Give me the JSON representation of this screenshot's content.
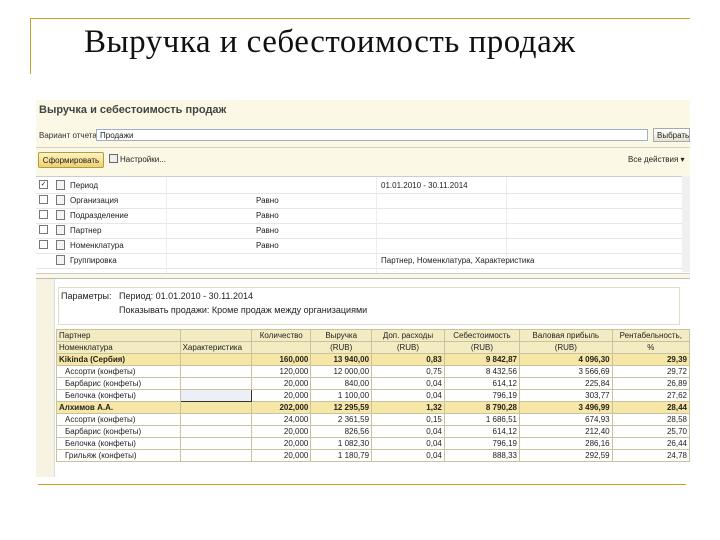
{
  "slide": {
    "title": "Выручка и себестоимость продаж"
  },
  "app": {
    "title": "Выручка и себестоимость продаж",
    "variant_label": "Вариант отчета",
    "variant_value": "Продажи",
    "select_variant_label": "Выбрать вариант...",
    "generate_label": "Сформировать",
    "settings_label": "Настройки...",
    "all_actions_label": "Все действия ▾"
  },
  "filters": [
    {
      "checked": true,
      "name": "Период",
      "condition": "",
      "value": "01.01.2010 - 30.11.2014"
    },
    {
      "checked": false,
      "name": "Организация",
      "condition": "Равно",
      "value": ""
    },
    {
      "checked": false,
      "name": "Подразделение",
      "condition": "Равно",
      "value": ""
    },
    {
      "checked": false,
      "name": "Партнер",
      "condition": "Равно",
      "value": ""
    },
    {
      "checked": false,
      "name": "Номенклатура",
      "condition": "Равно",
      "value": ""
    },
    {
      "checked": null,
      "name": "Группировка",
      "condition": "",
      "value": "Партнер, Номенклатура, Характеристика"
    }
  ],
  "report": {
    "params_label": "Параметры:",
    "period_text": "Период: 01.01.2010 - 30.11.2014",
    "show_text": "Показывать продажи: Кроме продаж между организациями",
    "headers": {
      "partner": "Партнер",
      "nomenclature": "Номенклатура",
      "characteristic": "Характеристика",
      "quantity": "Количество",
      "revenue": "Выручка",
      "revenue_unit": "(RUB)",
      "extra": "Доп. расходы",
      "extra_unit": "(RUB)",
      "cost": "Себестоимость",
      "cost_unit": "(RUB)",
      "profit": "Валовая прибыль",
      "profit_unit": "(RUB)",
      "margin": "Рентабельность,",
      "margin_unit": "%"
    },
    "rows": [
      {
        "type": "group",
        "name": "Kikinda (Сербия)",
        "char": "",
        "qty": "160,000",
        "rev": "13 940,00",
        "extra": "0,83",
        "cost": "9 842,87",
        "profit": "4 096,30",
        "margin": "29,39"
      },
      {
        "type": "item",
        "name": "Ассорти (конфеты)",
        "char": "",
        "qty": "120,000",
        "rev": "12 000,00",
        "extra": "0,75",
        "cost": "8 432,56",
        "profit": "3 566,69",
        "margin": "29,72"
      },
      {
        "type": "item",
        "name": "Барбарис (конфеты)",
        "char": "",
        "qty": "20,000",
        "rev": "840,00",
        "extra": "0,04",
        "cost": "614,12",
        "profit": "225,84",
        "margin": "26,89"
      },
      {
        "type": "item",
        "name": "Белочка (конфеты)",
        "char": "",
        "qty": "20,000",
        "rev": "1 100,00",
        "extra": "0,04",
        "cost": "796,19",
        "profit": "303,77",
        "margin": "27,62"
      },
      {
        "type": "group",
        "name": "Алхимов А.А.",
        "char": "",
        "qty": "202,000",
        "rev": "12 295,59",
        "extra": "1,32",
        "cost": "8 790,28",
        "profit": "3 496,99",
        "margin": "28,44"
      },
      {
        "type": "item",
        "name": "Ассорти (конфеты)",
        "char": "",
        "qty": "24,000",
        "rev": "2 361,59",
        "extra": "0,15",
        "cost": "1 686,51",
        "profit": "674,93",
        "margin": "28,58"
      },
      {
        "type": "item",
        "name": "Барбарис (конфеты)",
        "char": "",
        "qty": "20,000",
        "rev": "826,56",
        "extra": "0,04",
        "cost": "614,12",
        "profit": "212,40",
        "margin": "25,70"
      },
      {
        "type": "item",
        "name": "Белочка (конфеты)",
        "char": "",
        "qty": "20,000",
        "rev": "1 082,30",
        "extra": "0,04",
        "cost": "796,19",
        "profit": "286,16",
        "margin": "26,44"
      },
      {
        "type": "item",
        "name": "Грильяж (конфеты)",
        "char": "",
        "qty": "20,000",
        "rev": "1 180,79",
        "extra": "0,04",
        "cost": "888,33",
        "profit": "292,59",
        "margin": "24,78"
      }
    ]
  }
}
